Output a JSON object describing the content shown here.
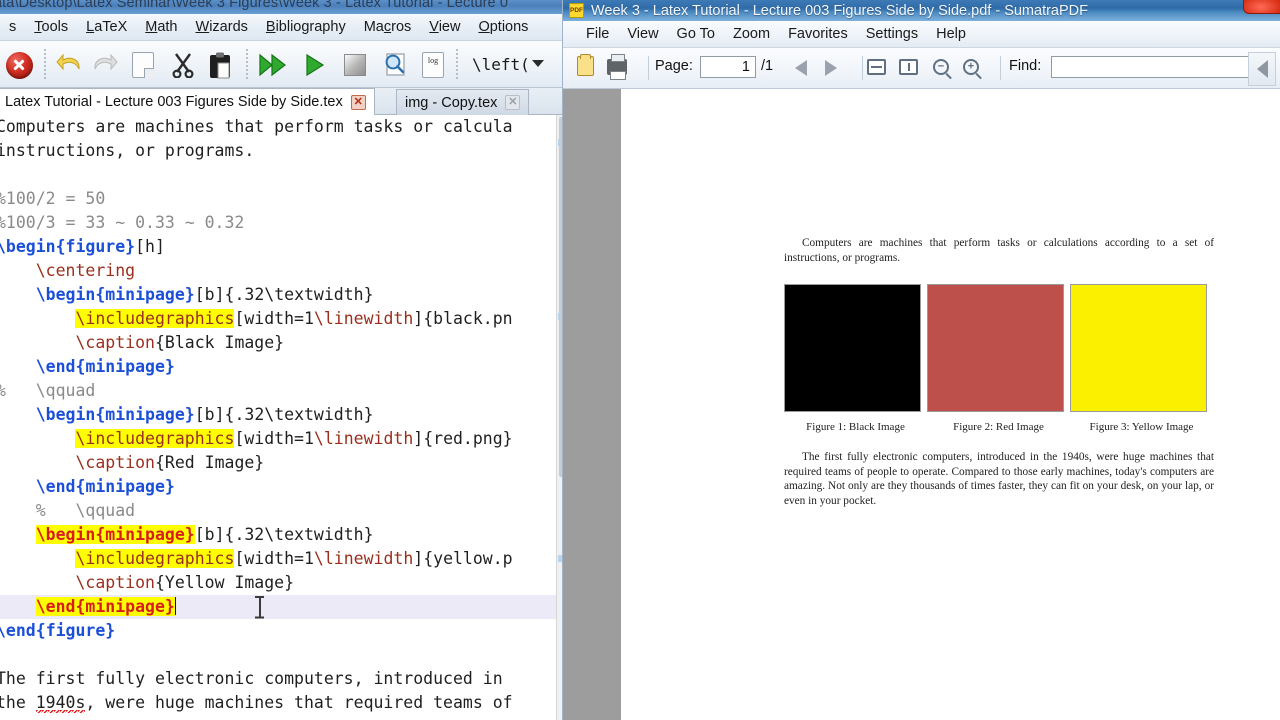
{
  "editor": {
    "titlebar": "ata\\Desktop\\Latex Seminar\\Week 3 Figures\\Week 3 - Latex Tutorial - Lecture 0",
    "menu": [
      {
        "label": "s",
        "accel": ""
      },
      {
        "label": "Tools",
        "accel": "T"
      },
      {
        "label": "LaTeX",
        "accel": "L"
      },
      {
        "label": "Math",
        "accel": "M"
      },
      {
        "label": "Wizards",
        "accel": "W"
      },
      {
        "label": "Bibliography",
        "accel": "B"
      },
      {
        "label": "Macros",
        "accel": "c"
      },
      {
        "label": "View",
        "accel": "V"
      },
      {
        "label": "Options",
        "accel": "O"
      }
    ],
    "toolbar": {
      "stop": "stop-icon",
      "undo": "undo-icon",
      "redo": "redo-icon",
      "new": "new-document-icon",
      "cut": "cut-scissors-icon",
      "paste": "paste-clipboard-icon",
      "build_and_view": "build-and-view-icon",
      "compile": "compile-run-icon",
      "stop_compile": "stop-compile-icon",
      "preview": "magnifier-preview-icon",
      "log": "log",
      "bracket_select": "\\left(",
      "bracket_dropdown": "chevron-down-icon"
    },
    "tabs": [
      {
        "label": "Latex Tutorial - Lecture 003 Figures Side by Side.tex",
        "active": true,
        "close": "✕"
      },
      {
        "label": "img - Copy.tex",
        "active": false,
        "close": "✕"
      }
    ],
    "code_lines": [
      [
        {
          "t": "Computers are machines that perform tasks or calcula",
          "c": "k-plain"
        }
      ],
      [
        {
          "t": "instructions, or programs.",
          "c": "k-plain"
        }
      ],
      [],
      [
        {
          "t": "%100/2 = 50",
          "c": "k-gray"
        }
      ],
      [
        {
          "t": "%100/3 = 33 ~ 0.33 ~ 0.32",
          "c": "k-gray"
        }
      ],
      [
        {
          "t": "\\begin",
          "c": "k-blue"
        },
        {
          "t": "{",
          "c": "k-blue"
        },
        {
          "t": "figure",
          "c": "k-blue"
        },
        {
          "t": "}",
          "c": "k-blue"
        },
        {
          "t": "[h]",
          "c": "k-plain"
        }
      ],
      [
        {
          "t": "    \\centering",
          "c": "k-dred"
        }
      ],
      [
        {
          "t": "    ",
          "c": "k-plain"
        },
        {
          "t": "\\begin",
          "c": "k-blue"
        },
        {
          "t": "{",
          "c": "k-blue"
        },
        {
          "t": "minipage",
          "c": "k-blue"
        },
        {
          "t": "}",
          "c": "k-blue"
        },
        {
          "t": "[b]{.32",
          "c": "k-plain"
        },
        {
          "t": "\\textwidth",
          "c": "k-plain"
        },
        {
          "t": "}",
          "c": "k-plain"
        }
      ],
      [
        {
          "t": "        ",
          "c": "k-plain"
        },
        {
          "t": "\\includegraphics",
          "c": "k-dred hl-y"
        },
        {
          "t": "[width=1",
          "c": "k-plain"
        },
        {
          "t": "\\linewidth",
          "c": "k-dred"
        },
        {
          "t": "]{black.pn",
          "c": "k-plain"
        }
      ],
      [
        {
          "t": "        ",
          "c": "k-plain"
        },
        {
          "t": "\\caption",
          "c": "k-dred"
        },
        {
          "t": "{Black Image}",
          "c": "k-plain"
        }
      ],
      [
        {
          "t": "    ",
          "c": "k-plain"
        },
        {
          "t": "\\end",
          "c": "k-blue"
        },
        {
          "t": "{",
          "c": "k-blue"
        },
        {
          "t": "minipage",
          "c": "k-blue"
        },
        {
          "t": "}",
          "c": "k-blue"
        }
      ],
      [
        {
          "t": "%   \\qquad",
          "c": "k-gray"
        }
      ],
      [
        {
          "t": "    ",
          "c": "k-plain"
        },
        {
          "t": "\\begin",
          "c": "k-blue"
        },
        {
          "t": "{",
          "c": "k-blue"
        },
        {
          "t": "minipage",
          "c": "k-blue"
        },
        {
          "t": "}",
          "c": "k-blue"
        },
        {
          "t": "[b]{.32",
          "c": "k-plain"
        },
        {
          "t": "\\textwidth",
          "c": "k-plain"
        },
        {
          "t": "}",
          "c": "k-plain"
        }
      ],
      [
        {
          "t": "        ",
          "c": "k-plain"
        },
        {
          "t": "\\includegraphics",
          "c": "k-dred hl-y"
        },
        {
          "t": "[width=1",
          "c": "k-plain"
        },
        {
          "t": "\\linewidth",
          "c": "k-dred"
        },
        {
          "t": "]{red.png}",
          "c": "k-plain"
        }
      ],
      [
        {
          "t": "        ",
          "c": "k-plain"
        },
        {
          "t": "\\caption",
          "c": "k-dred"
        },
        {
          "t": "{Red Image}",
          "c": "k-plain"
        }
      ],
      [
        {
          "t": "    ",
          "c": "k-plain"
        },
        {
          "t": "\\end",
          "c": "k-blue"
        },
        {
          "t": "{",
          "c": "k-blue"
        },
        {
          "t": "minipage",
          "c": "k-blue"
        },
        {
          "t": "}",
          "c": "k-blue"
        }
      ],
      [
        {
          "t": "    %   \\qquad",
          "c": "k-gray"
        }
      ],
      [
        {
          "t": "    ",
          "c": "k-plain"
        },
        {
          "t": "\\begin{minipage}",
          "c": "k-red hl-y"
        },
        {
          "t": "[b]{.32",
          "c": "k-plain"
        },
        {
          "t": "\\textwidth",
          "c": "k-plain"
        },
        {
          "t": "}",
          "c": "k-plain"
        }
      ],
      [
        {
          "t": "        ",
          "c": "k-plain"
        },
        {
          "t": "\\includegraphics",
          "c": "k-dred hl-y"
        },
        {
          "t": "[width=1",
          "c": "k-plain"
        },
        {
          "t": "\\linewidth",
          "c": "k-dred"
        },
        {
          "t": "]{yellow.p",
          "c": "k-plain"
        }
      ],
      [
        {
          "t": "        ",
          "c": "k-plain"
        },
        {
          "t": "\\caption",
          "c": "k-dred"
        },
        {
          "t": "{Yellow Image}",
          "c": "k-plain"
        }
      ],
      [
        {
          "t": "    ",
          "c": "k-plain"
        },
        {
          "t": "\\end{minipage}",
          "c": "k-red hl-y"
        }
      ],
      [
        {
          "t": "\\end",
          "c": "k-blue"
        },
        {
          "t": "{",
          "c": "k-blue"
        },
        {
          "t": "figure",
          "c": "k-blue"
        },
        {
          "t": "}",
          "c": "k-blue"
        }
      ],
      [],
      [
        {
          "t": "The first fully electronic computers, introduced in",
          "c": "k-plain"
        }
      ],
      [
        {
          "t": "the ",
          "c": "k-plain"
        },
        {
          "t": "1940s",
          "c": "k-plain squig"
        },
        {
          "t": ", were huge machines that required teams of",
          "c": "k-plain"
        }
      ]
    ],
    "cursor_line_index": 20
  },
  "pdf": {
    "title": "Week 3 - Latex Tutorial - Lecture 003 Figures Side by Side.pdf - SumatraPDF",
    "app_icon_label": "PDF",
    "menu": [
      "File",
      "View",
      "Go To",
      "Zoom",
      "Favorites",
      "Settings",
      "Help"
    ],
    "toolbar": {
      "open": "open-file-icon",
      "print": "print-icon",
      "page_label": "Page:",
      "page_value": "1",
      "page_total": "/1",
      "prev": "previous-page-icon",
      "next": "next-page-icon",
      "fit_width": "fit-width-icon",
      "fit_page": "fit-page-icon",
      "zoom_out": "−",
      "zoom_in": "+",
      "find_label": "Find:",
      "find_value": "",
      "find_placeholder": ""
    },
    "document": {
      "paragraph1": "Computers are machines that perform tasks or calculations according to a set of instructions, or programs.",
      "figures": [
        {
          "caption": "Figure 1: Black Image",
          "color": "#000000"
        },
        {
          "caption": "Figure 2: Red Image",
          "color": "#bd504a"
        },
        {
          "caption": "Figure 3: Yellow Image",
          "color": "#fbf000"
        }
      ],
      "paragraph2": "The first fully electronic computers, introduced in the 1940s, were huge machines that required teams of people to operate. Compared to those early machines, today's computers are amazing. Not only are they thousands of times faster, they can fit on your desk, on your lap, or even in your pocket."
    }
  },
  "colors": {
    "accent_blue": "#1b4fd8",
    "keyword_red": "#d81c1c",
    "command_dred": "#9b2f1e",
    "highlight_yellow": "#ffff00",
    "comment_gray": "#8a8a8a",
    "titlebar_blue": "#2f6ba8"
  }
}
